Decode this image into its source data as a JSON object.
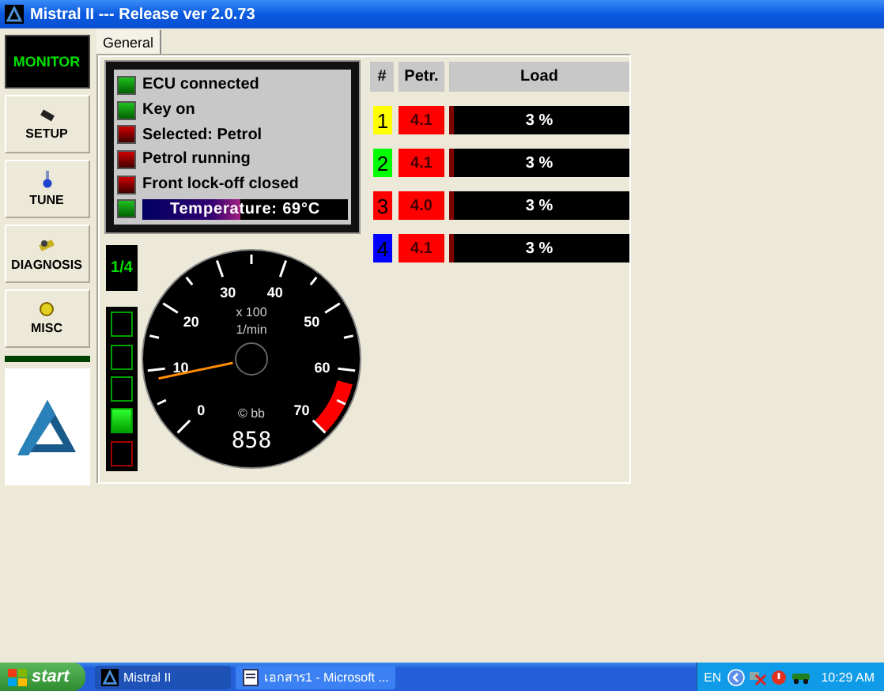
{
  "window": {
    "title": "Mistral II --- Release ver 2.0.73"
  },
  "sidebar": {
    "items": [
      {
        "label": "MONITOR",
        "selected": true,
        "kind": "monitor"
      },
      {
        "label": "SETUP",
        "selected": false,
        "kind": "setup"
      },
      {
        "label": "TUNE",
        "selected": false,
        "kind": "tune"
      },
      {
        "label": "DIAGNOSIS",
        "selected": false,
        "kind": "diagnosis"
      },
      {
        "label": "MISC",
        "selected": false,
        "kind": "misc"
      }
    ]
  },
  "tabs": [
    {
      "label": "General",
      "selected": true
    }
  ],
  "status": {
    "lamps": [
      {
        "label": "ECU connected",
        "on": true
      },
      {
        "label": "Key on",
        "on": true
      },
      {
        "label": "Selected: Petrol",
        "on": false
      },
      {
        "label": "Petrol running",
        "on": false
      },
      {
        "label": "Front lock-off closed",
        "on": false
      }
    ],
    "temperature": {
      "on": true,
      "label": "Temperature: 69°C",
      "level": 0.48
    }
  },
  "cylinders": {
    "columns": [
      "#",
      "Petr.",
      "Load"
    ],
    "rows": [
      {
        "number": "1",
        "color": "#ffff00",
        "petrol": "4.1",
        "load": "3 %",
        "level": 0.03
      },
      {
        "number": "2",
        "color": "#00ff00",
        "petrol": "4.1",
        "load": "3 %",
        "level": 0.03
      },
      {
        "number": "3",
        "color": "#ff0000",
        "petrol": "4.0",
        "load": "3 %",
        "level": 0.03
      },
      {
        "number": "4",
        "color": "#0000ff",
        "petrol": "4.1",
        "load": "3 %",
        "level": 0.03
      }
    ]
  },
  "gear": {
    "label": "1/4",
    "segments": [
      {
        "lit": false,
        "color": "#00a000"
      },
      {
        "lit": false,
        "color": "#00a000"
      },
      {
        "lit": false,
        "color": "#00a000"
      },
      {
        "lit": true,
        "color": "#00a000"
      },
      {
        "lit": false,
        "color": "#a00000"
      }
    ]
  },
  "gauge": {
    "scale_labels": [
      "0",
      "10",
      "20",
      "30",
      "40",
      "50",
      "60",
      "70"
    ],
    "multiplier": "x 100",
    "unit": "1/min",
    "brand": "© bb",
    "reading": "858",
    "level": 0.1226
  },
  "taskbar": {
    "start": "start",
    "tasks": [
      {
        "label": "Mistral II",
        "selected": true,
        "kind": "app"
      },
      {
        "label": "เอกสาร1 - Microsoft ...",
        "selected": false,
        "kind": "document"
      }
    ],
    "language": "EN",
    "clock": "10:29 AM"
  }
}
